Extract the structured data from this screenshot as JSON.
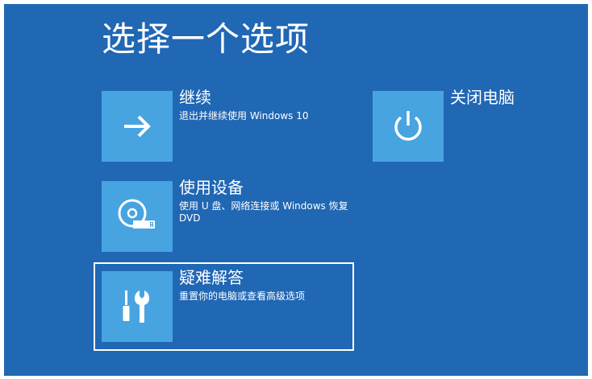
{
  "page": {
    "title": "选择一个选项"
  },
  "options": [
    {
      "id": "continue",
      "label": "继续",
      "description": "退出并继续使用 Windows 10",
      "icon": "arrow-right-icon"
    },
    {
      "id": "use-device",
      "label": "使用设备",
      "description": "使用 U 盘、网络连接或 Windows 恢复 DVD",
      "icon": "disc-usb-icon"
    },
    {
      "id": "troubleshoot",
      "label": "疑难解答",
      "description": "重置你的电脑或查看高级选项",
      "icon": "tools-icon"
    },
    {
      "id": "shutdown",
      "label": "关闭电脑",
      "description": "",
      "icon": "power-icon"
    }
  ],
  "colors": {
    "background": "#2067b4",
    "tile": "#48a4e0",
    "text": "#ffffff",
    "focus_border": "#ffffff"
  },
  "focused_option": "troubleshoot"
}
